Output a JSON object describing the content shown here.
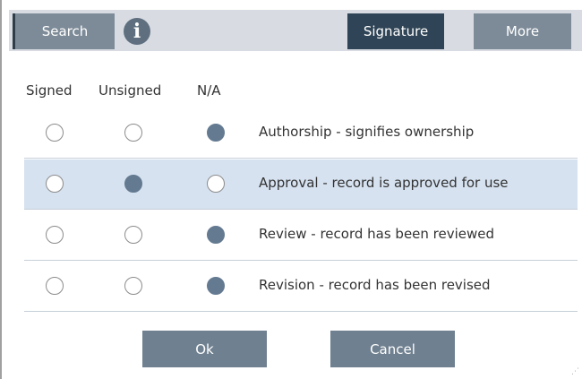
{
  "toolbar": {
    "search_label": "Search",
    "info_icon": "info-icon",
    "info_glyph": "i",
    "signature_label": "Signature",
    "more_label": "More"
  },
  "columns": {
    "signed": "Signed",
    "unsigned": "Unsigned",
    "na": "N/A"
  },
  "rows": [
    {
      "label": "Authorship - signifies ownership",
      "selected_option": "N/A",
      "highlighted": false
    },
    {
      "label": "Approval - record is approved for use",
      "selected_option": "Unsigned",
      "highlighted": true
    },
    {
      "label": "Review - record has been reviewed",
      "selected_option": "N/A",
      "highlighted": false
    },
    {
      "label": "Revision - record has been revised",
      "selected_option": "N/A",
      "highlighted": false
    }
  ],
  "footer": {
    "ok_label": "Ok",
    "cancel_label": "Cancel"
  },
  "colors": {
    "toolbar_bg": "#d8dce2",
    "button": "#7d8b98",
    "button_active": "#2f4456",
    "radio_checked": "#647a91",
    "row_highlight": "#d6e2f0"
  }
}
